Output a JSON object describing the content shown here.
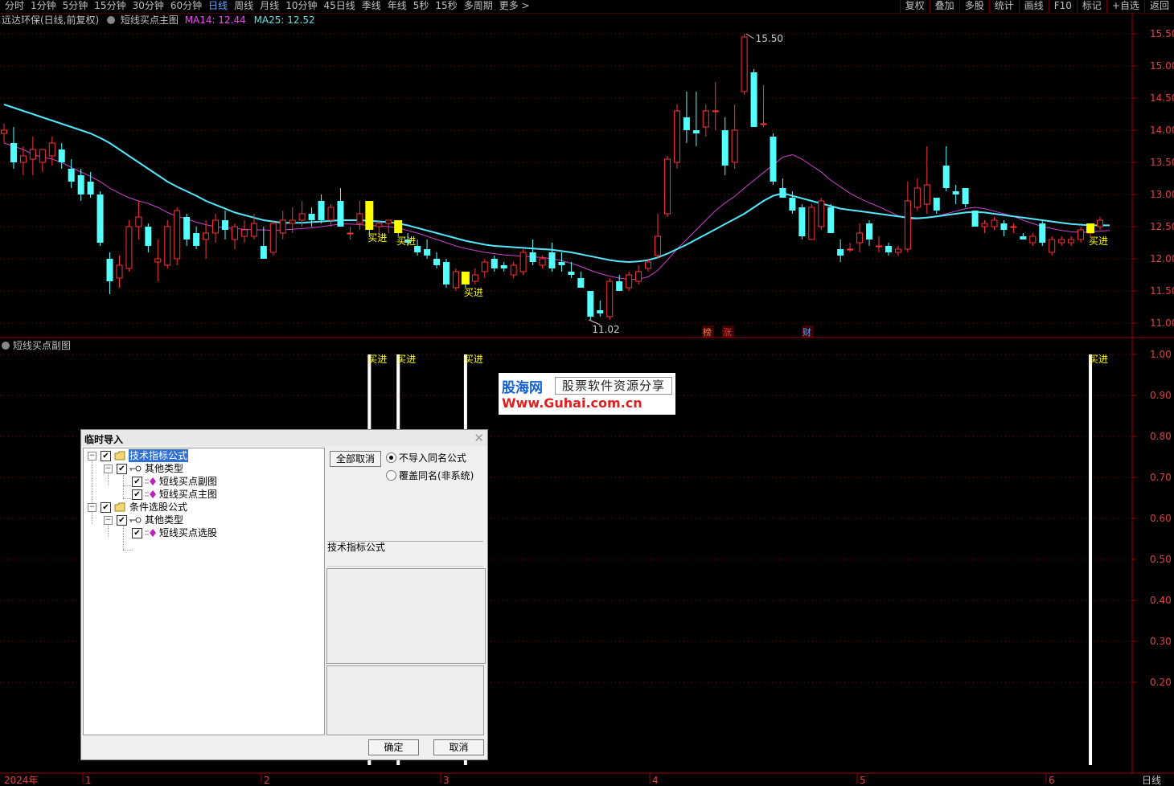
{
  "toolbar": {
    "periods": [
      "分时",
      "1分钟",
      "5分钟",
      "15分钟",
      "30分钟",
      "60分钟",
      "日线",
      "周线",
      "月线",
      "10分钟",
      "45日线",
      "季线",
      "年线",
      "5秒",
      "15秒",
      "多周期",
      "更多 >"
    ],
    "active_period": "日线",
    "right_buttons": [
      "复权",
      "叠加",
      "多股",
      "统计",
      "画线",
      "F10",
      "标记",
      "+自选",
      "返回"
    ]
  },
  "main_pane": {
    "stock_title": "远达环保(日线,前复权)",
    "indicator_name": "短线买点主图",
    "ma14_text": "MA14: 12.44",
    "ma25_text": "MA25: 12.52",
    "high_label": "15.50",
    "low_label": "11.02",
    "buy_label": "买进",
    "event_tags": [
      "榜",
      "涨",
      "财"
    ],
    "y_axis_ticks": [
      "15.50",
      "15.00",
      "14.50",
      "14.00",
      "13.50",
      "13.00",
      "12.50",
      "12.00",
      "11.50",
      "11.00"
    ]
  },
  "sub_pane": {
    "title": "短线买点副图",
    "buy_label": "买进",
    "y_axis_ticks": [
      "1.00",
      "0.90",
      "0.80",
      "0.70",
      "0.60",
      "0.50",
      "0.40",
      "0.30",
      "0.20"
    ]
  },
  "x_axis": {
    "labels": [
      "2024年",
      "1",
      "2",
      "3",
      "4",
      "5",
      "6"
    ],
    "period_label": "日线"
  },
  "watermark": {
    "logo": "股海网",
    "slogan": "股票软件资源分享",
    "url": "Www.Guhai.com.cn"
  },
  "dialog": {
    "title": "临时导入",
    "tree": {
      "group1": "技术指标公式",
      "group1_sub": "其他类型",
      "item1": "短线买点副图",
      "item2": "短线买点主图",
      "group2": "条件选股公式",
      "group2_sub": "其他类型",
      "item3": "短线买点选股"
    },
    "unselect_all": "全部取消",
    "radio1": "不导入同名公式",
    "radio2": "覆盖同名(非系统)",
    "type_label": "技术指标公式",
    "ok": "确定",
    "cancel": "取消"
  },
  "colors": {
    "up": "#ff3232",
    "down": "#54ffff",
    "ma14": "#d040d0",
    "ma25": "#54e8ff",
    "buy": "#ffff00",
    "grid": "#800000",
    "axis_text": "#e04040"
  },
  "chart_data": {
    "type": "candlestick",
    "y_range": [
      10.8,
      15.65
    ],
    "candles": [
      {
        "o": 13.95,
        "h": 14.1,
        "l": 13.8,
        "c": 14.0
      },
      {
        "o": 13.8,
        "h": 14.05,
        "l": 13.4,
        "c": 13.5
      },
      {
        "o": 13.5,
        "h": 13.75,
        "l": 13.3,
        "c": 13.6
      },
      {
        "o": 13.55,
        "h": 13.9,
        "l": 13.3,
        "c": 13.7
      },
      {
        "o": 13.5,
        "h": 13.7,
        "l": 13.35,
        "c": 13.7
      },
      {
        "o": 13.6,
        "h": 13.9,
        "l": 13.45,
        "c": 13.8
      },
      {
        "o": 13.7,
        "h": 13.8,
        "l": 13.4,
        "c": 13.5
      },
      {
        "o": 13.4,
        "h": 13.55,
        "l": 13.1,
        "c": 13.2
      },
      {
        "o": 13.3,
        "h": 13.4,
        "l": 12.9,
        "c": 13.0
      },
      {
        "o": 13.2,
        "h": 13.35,
        "l": 12.95,
        "c": 13.0
      },
      {
        "o": 13.0,
        "h": 13.05,
        "l": 12.2,
        "c": 12.25
      },
      {
        "o": 12.0,
        "h": 12.1,
        "l": 11.45,
        "c": 11.65
      },
      {
        "o": 11.7,
        "h": 12.05,
        "l": 11.55,
        "c": 11.9
      },
      {
        "o": 11.85,
        "h": 12.6,
        "l": 11.8,
        "c": 12.5
      },
      {
        "o": 12.5,
        "h": 12.9,
        "l": 12.3,
        "c": 12.65
      },
      {
        "o": 12.5,
        "h": 12.55,
        "l": 12.1,
        "c": 12.2
      },
      {
        "o": 11.95,
        "h": 12.3,
        "l": 11.65,
        "c": 12.0
      },
      {
        "o": 11.9,
        "h": 12.6,
        "l": 11.85,
        "c": 12.5
      },
      {
        "o": 12.0,
        "h": 12.8,
        "l": 11.9,
        "c": 12.75
      },
      {
        "o": 12.65,
        "h": 12.7,
        "l": 12.2,
        "c": 12.3
      },
      {
        "o": 12.4,
        "h": 12.5,
        "l": 12.15,
        "c": 12.2
      },
      {
        "o": 12.3,
        "h": 12.6,
        "l": 12.0,
        "c": 12.4
      },
      {
        "o": 12.4,
        "h": 12.7,
        "l": 12.25,
        "c": 12.6
      },
      {
        "o": 12.6,
        "h": 12.75,
        "l": 12.3,
        "c": 12.45
      },
      {
        "o": 12.3,
        "h": 12.55,
        "l": 12.15,
        "c": 12.5
      },
      {
        "o": 12.35,
        "h": 12.6,
        "l": 12.25,
        "c": 12.45
      },
      {
        "o": 12.35,
        "h": 12.7,
        "l": 12.3,
        "c": 12.55
      },
      {
        "o": 12.2,
        "h": 12.5,
        "l": 12.0,
        "c": 12.0
      },
      {
        "o": 12.1,
        "h": 12.6,
        "l": 12.05,
        "c": 12.55
      },
      {
        "o": 12.4,
        "h": 12.75,
        "l": 12.3,
        "c": 12.6
      },
      {
        "o": 12.55,
        "h": 12.8,
        "l": 12.4,
        "c": 12.6
      },
      {
        "o": 12.6,
        "h": 12.9,
        "l": 12.5,
        "c": 12.7
      },
      {
        "o": 12.7,
        "h": 12.8,
        "l": 12.5,
        "c": 12.6
      },
      {
        "o": 12.9,
        "h": 13.0,
        "l": 12.55,
        "c": 12.6
      },
      {
        "o": 12.6,
        "h": 12.85,
        "l": 12.5,
        "c": 12.8
      },
      {
        "o": 12.9,
        "h": 13.1,
        "l": 12.55,
        "c": 12.5
      },
      {
        "o": 12.4,
        "h": 12.5,
        "l": 12.3,
        "c": 12.4
      },
      {
        "o": 12.55,
        "h": 12.9,
        "l": 12.45,
        "c": 12.7
      },
      {
        "o": 12.8,
        "h": 12.9,
        "l": 12.35,
        "c": 12.45
      },
      {
        "o": 12.5,
        "h": 12.6,
        "l": 12.35,
        "c": 12.55
      },
      {
        "o": 12.55,
        "h": 12.6,
        "l": 12.4,
        "c": 12.6
      },
      {
        "o": 12.5,
        "h": 12.55,
        "l": 12.35,
        "c": 12.4
      },
      {
        "o": 12.3,
        "h": 12.4,
        "l": 12.2,
        "c": 12.25
      },
      {
        "o": 12.2,
        "h": 12.3,
        "l": 12.05,
        "c": 12.1
      },
      {
        "o": 12.15,
        "h": 12.3,
        "l": 12.0,
        "c": 12.05
      },
      {
        "o": 12.0,
        "h": 12.1,
        "l": 11.85,
        "c": 11.9
      },
      {
        "o": 11.95,
        "h": 12.0,
        "l": 11.55,
        "c": 11.6
      },
      {
        "o": 11.55,
        "h": 11.85,
        "l": 11.5,
        "c": 11.8
      },
      {
        "o": 11.7,
        "h": 11.8,
        "l": 11.55,
        "c": 11.6
      },
      {
        "o": 11.65,
        "h": 11.85,
        "l": 11.6,
        "c": 11.75
      },
      {
        "o": 11.8,
        "h": 12.0,
        "l": 11.7,
        "c": 11.95
      },
      {
        "o": 12.0,
        "h": 12.05,
        "l": 11.8,
        "c": 11.85
      },
      {
        "o": 11.9,
        "h": 11.95,
        "l": 11.8,
        "c": 11.85
      },
      {
        "o": 11.75,
        "h": 11.95,
        "l": 11.7,
        "c": 11.9
      },
      {
        "o": 11.8,
        "h": 12.15,
        "l": 11.75,
        "c": 12.1
      },
      {
        "o": 12.1,
        "h": 12.3,
        "l": 11.9,
        "c": 11.95
      },
      {
        "o": 11.9,
        "h": 12.05,
        "l": 11.85,
        "c": 12.0
      },
      {
        "o": 12.1,
        "h": 12.25,
        "l": 11.8,
        "c": 11.85
      },
      {
        "o": 11.95,
        "h": 12.1,
        "l": 11.8,
        "c": 11.9
      },
      {
        "o": 11.8,
        "h": 11.95,
        "l": 11.7,
        "c": 11.75
      },
      {
        "o": 11.7,
        "h": 11.8,
        "l": 11.55,
        "c": 11.55
      },
      {
        "o": 11.5,
        "h": 11.5,
        "l": 11.05,
        "c": 11.1
      },
      {
        "o": 11.2,
        "h": 11.35,
        "l": 11.1,
        "c": 11.15
      },
      {
        "o": 11.1,
        "h": 11.7,
        "l": 11.05,
        "c": 11.65
      },
      {
        "o": 11.65,
        "h": 11.75,
        "l": 11.5,
        "c": 11.5
      },
      {
        "o": 11.55,
        "h": 11.8,
        "l": 11.5,
        "c": 11.75
      },
      {
        "o": 11.65,
        "h": 11.9,
        "l": 11.6,
        "c": 11.8
      },
      {
        "o": 11.85,
        "h": 12.0,
        "l": 11.8,
        "c": 11.95
      },
      {
        "o": 12.05,
        "h": 12.7,
        "l": 12.0,
        "c": 12.35
      },
      {
        "o": 12.7,
        "h": 13.6,
        "l": 12.65,
        "c": 13.55
      },
      {
        "o": 13.5,
        "h": 14.4,
        "l": 13.4,
        "c": 14.3
      },
      {
        "o": 14.2,
        "h": 14.6,
        "l": 13.8,
        "c": 14.0
      },
      {
        "o": 14.0,
        "h": 14.6,
        "l": 13.75,
        "c": 13.95
      },
      {
        "o": 14.05,
        "h": 14.4,
        "l": 13.9,
        "c": 14.3
      },
      {
        "o": 14.3,
        "h": 14.75,
        "l": 14.0,
        "c": 14.3
      },
      {
        "o": 14.0,
        "h": 14.2,
        "l": 13.3,
        "c": 13.45
      },
      {
        "o": 13.5,
        "h": 14.4,
        "l": 13.4,
        "c": 14.0
      },
      {
        "o": 14.6,
        "h": 15.5,
        "l": 14.55,
        "c": 15.45
      },
      {
        "o": 14.9,
        "h": 14.95,
        "l": 14.05,
        "c": 14.05
      },
      {
        "o": 14.1,
        "h": 14.7,
        "l": 14.05,
        "c": 14.1
      },
      {
        "o": 13.9,
        "h": 13.95,
        "l": 13.15,
        "c": 13.2
      },
      {
        "o": 13.1,
        "h": 13.25,
        "l": 12.95,
        "c": 12.95
      },
      {
        "o": 12.95,
        "h": 13.05,
        "l": 12.7,
        "c": 12.75
      },
      {
        "o": 12.8,
        "h": 12.85,
        "l": 12.3,
        "c": 12.35
      },
      {
        "o": 12.3,
        "h": 12.85,
        "l": 12.3,
        "c": 12.8
      },
      {
        "o": 12.5,
        "h": 12.95,
        "l": 12.45,
        "c": 12.9
      },
      {
        "o": 12.8,
        "h": 12.85,
        "l": 12.4,
        "c": 12.4
      },
      {
        "o": 12.15,
        "h": 12.3,
        "l": 11.95,
        "c": 12.05
      },
      {
        "o": 12.15,
        "h": 12.25,
        "l": 12.1,
        "c": 12.15
      },
      {
        "o": 12.25,
        "h": 12.55,
        "l": 12.1,
        "c": 12.4
      },
      {
        "o": 12.55,
        "h": 12.6,
        "l": 12.2,
        "c": 12.3
      },
      {
        "o": 12.2,
        "h": 12.35,
        "l": 12.1,
        "c": 12.2
      },
      {
        "o": 12.2,
        "h": 12.25,
        "l": 12.05,
        "c": 12.1
      },
      {
        "o": 12.1,
        "h": 12.2,
        "l": 12.05,
        "c": 12.15
      },
      {
        "o": 12.15,
        "h": 13.2,
        "l": 12.1,
        "c": 12.9
      },
      {
        "o": 12.8,
        "h": 13.25,
        "l": 12.75,
        "c": 13.1
      },
      {
        "o": 12.85,
        "h": 13.75,
        "l": 12.7,
        "c": 13.15
      },
      {
        "o": 12.95,
        "h": 12.95,
        "l": 12.7,
        "c": 12.75
      },
      {
        "o": 13.45,
        "h": 13.75,
        "l": 13.05,
        "c": 13.1
      },
      {
        "o": 13.05,
        "h": 13.15,
        "l": 12.85,
        "c": 13.0
      },
      {
        "o": 13.1,
        "h": 13.1,
        "l": 12.8,
        "c": 12.85
      },
      {
        "o": 12.75,
        "h": 12.75,
        "l": 12.5,
        "c": 12.5
      },
      {
        "o": 12.5,
        "h": 12.6,
        "l": 12.4,
        "c": 12.55
      },
      {
        "o": 12.5,
        "h": 12.65,
        "l": 12.45,
        "c": 12.6
      },
      {
        "o": 12.55,
        "h": 12.6,
        "l": 12.35,
        "c": 12.45
      },
      {
        "o": 12.5,
        "h": 12.55,
        "l": 12.4,
        "c": 12.5
      },
      {
        "o": 12.35,
        "h": 12.4,
        "l": 12.3,
        "c": 12.3
      },
      {
        "o": 12.25,
        "h": 12.4,
        "l": 12.2,
        "c": 12.35
      },
      {
        "o": 12.55,
        "h": 12.6,
        "l": 12.2,
        "c": 12.25
      },
      {
        "o": 12.1,
        "h": 12.35,
        "l": 12.05,
        "c": 12.3
      },
      {
        "o": 12.25,
        "h": 12.35,
        "l": 12.2,
        "c": 12.3
      },
      {
        "o": 12.25,
        "h": 12.35,
        "l": 12.2,
        "c": 12.3
      },
      {
        "o": 12.3,
        "h": 12.5,
        "l": 12.25,
        "c": 12.45
      },
      {
        "o": 12.4,
        "h": 12.5,
        "l": 12.35,
        "c": 12.45
      },
      {
        "o": 12.5,
        "h": 12.65,
        "l": 12.45,
        "c": 12.6
      }
    ],
    "ma14": [
      13.8,
      13.75,
      13.7,
      13.62,
      13.58,
      13.55,
      13.5,
      13.42,
      13.35,
      13.28,
      13.2,
      13.1,
      13.02,
      12.95,
      12.9,
      12.86,
      12.8,
      12.72,
      12.66,
      12.62,
      12.57,
      12.53,
      12.5,
      12.48,
      12.47,
      12.46,
      12.45,
      12.45,
      12.44,
      12.45,
      12.46,
      12.47,
      12.48,
      12.5,
      12.52,
      12.54,
      12.54,
      12.53,
      12.52,
      12.51,
      12.5,
      12.48,
      12.44,
      12.4,
      12.35,
      12.3,
      12.25,
      12.2,
      12.16,
      12.13,
      12.1,
      12.08,
      12.06,
      12.05,
      12.04,
      12.03,
      12.02,
      12.0,
      11.97,
      11.93,
      11.88,
      11.82,
      11.77,
      11.73,
      11.7,
      11.68,
      11.68,
      11.72,
      11.82,
      11.98,
      12.15,
      12.3,
      12.45,
      12.6,
      12.75,
      12.87,
      12.97,
      13.1,
      13.22,
      13.34,
      13.46,
      13.58,
      13.62,
      13.55,
      13.45,
      13.35,
      13.22,
      13.12,
      13.02,
      12.94,
      12.87,
      12.81,
      12.74,
      12.67,
      12.62,
      12.62,
      12.64,
      12.66,
      12.7,
      12.74,
      12.78,
      12.8,
      12.78,
      12.74,
      12.7,
      12.66,
      12.6,
      12.55,
      12.5,
      12.47,
      12.44,
      12.42,
      12.41,
      12.42,
      12.43,
      12.44
    ],
    "ma25": [
      14.4,
      14.35,
      14.3,
      14.25,
      14.2,
      14.15,
      14.1,
      14.05,
      14.0,
      13.95,
      13.88,
      13.8,
      13.7,
      13.6,
      13.5,
      13.4,
      13.3,
      13.2,
      13.12,
      13.05,
      12.98,
      12.9,
      12.84,
      12.78,
      12.72,
      12.68,
      12.64,
      12.6,
      12.58,
      12.56,
      12.56,
      12.56,
      12.57,
      12.58,
      12.59,
      12.6,
      12.6,
      12.6,
      12.59,
      12.58,
      12.57,
      12.55,
      12.52,
      12.48,
      12.44,
      12.4,
      12.36,
      12.32,
      12.28,
      12.25,
      12.22,
      12.2,
      12.19,
      12.18,
      12.17,
      12.16,
      12.15,
      12.14,
      12.12,
      12.1,
      12.07,
      12.04,
      12.01,
      11.98,
      11.96,
      11.95,
      11.96,
      11.98,
      12.02,
      12.08,
      12.15,
      12.22,
      12.3,
      12.38,
      12.46,
      12.54,
      12.62,
      12.7,
      12.8,
      12.9,
      12.98,
      13.02,
      12.98,
      12.94,
      12.9,
      12.86,
      12.82,
      12.78,
      12.76,
      12.74,
      12.72,
      12.7,
      12.68,
      12.66,
      12.64,
      12.63,
      12.64,
      12.66,
      12.68,
      12.7,
      12.72,
      12.73,
      12.72,
      12.7,
      12.68,
      12.66,
      12.64,
      12.62,
      12.6,
      12.58,
      12.56,
      12.54,
      12.53,
      12.52,
      12.52,
      12.52
    ],
    "buy_signals": [
      38,
      41,
      48,
      113
    ],
    "subchart_buy_value": 1.0
  }
}
